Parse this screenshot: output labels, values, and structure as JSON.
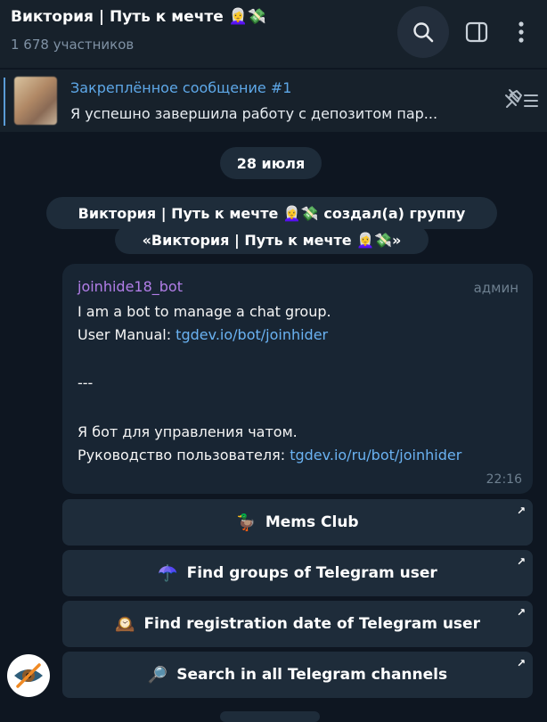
{
  "header": {
    "title": "Виктория | Путь к мечте 👩‍🦳💸",
    "subtitle": "1 678 участников",
    "icons": [
      "search-icon",
      "sidebar-toggle-icon",
      "more-vertical-icon"
    ]
  },
  "pinned": {
    "title": "Закреплённое сообщение #1",
    "text": "Я успешно завершила работу с депозитом пар..."
  },
  "service": {
    "date": "28 июля",
    "line1": "Виктория | Путь к мечте 👩‍🦳💸 создал(а) группу",
    "line2": "«Виктория | Путь к мечте 👩‍🦳💸»"
  },
  "message": {
    "sender": "joinhide18_bot",
    "role": "админ",
    "line1": "I am a bot to manage a chat group.",
    "line2_prefix": "User Manual: ",
    "line2_link": "tgdev.io/bot/joinhider",
    "line3": "---",
    "line4": "Я бот для управления чатом.",
    "line5_prefix": "Руководство пользователя: ",
    "line5_link": "tgdev.io/ru/bot/joinhider",
    "time": "22:16"
  },
  "keyboard": [
    {
      "emoji": "🦆",
      "label": "Mems Club"
    },
    {
      "emoji": "☂️",
      "label": "Find groups of Telegram user"
    },
    {
      "emoji": "🕰️",
      "label": "Find registration date of Telegram user"
    },
    {
      "emoji": "🔎",
      "label": "Search in all Telegram channels"
    }
  ],
  "keyboard_arrow": "↗",
  "colors": {
    "background": "#0e1621",
    "header": "#17212b",
    "bubble": "#182533",
    "button": "#1e2c3a",
    "link": "#6ab2f2",
    "sender": "#b27ee8",
    "pinned_title": "#5ea8e8"
  }
}
